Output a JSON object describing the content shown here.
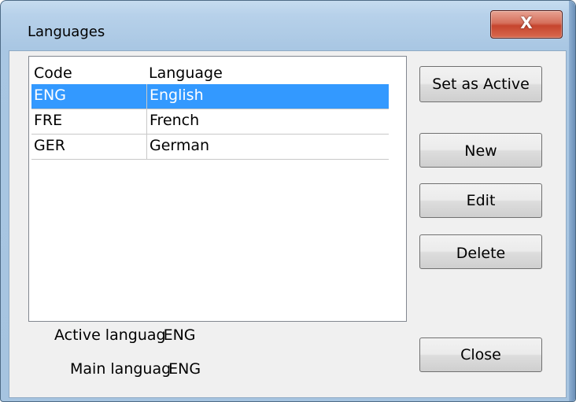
{
  "window": {
    "title": "Languages",
    "close_glyph": "X"
  },
  "list": {
    "headers": {
      "code": "Code",
      "language": "Language"
    },
    "rows": [
      {
        "code": "ENG",
        "language": "English",
        "selected": true
      },
      {
        "code": "FRE",
        "language": "French",
        "selected": false
      },
      {
        "code": "GER",
        "language": "German",
        "selected": false
      }
    ]
  },
  "buttons": {
    "set_active": "Set as Active",
    "new": "New",
    "edit": "Edit",
    "delete": "Delete",
    "close": "Close"
  },
  "status": {
    "active_label": "Active languag",
    "active_value": "ENG",
    "main_label": "Main languag",
    "main_value": "ENG"
  },
  "colors": {
    "selection": "#3399ff",
    "close_button": "#c6452e"
  }
}
